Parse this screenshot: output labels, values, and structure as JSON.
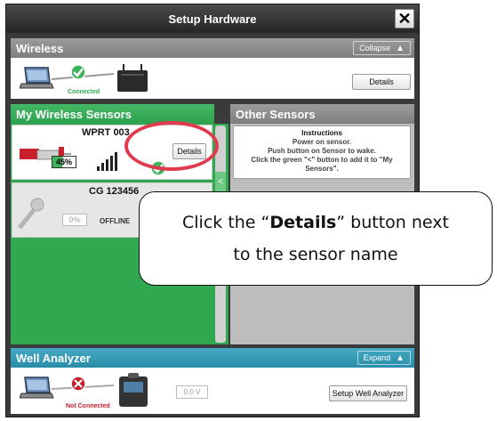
{
  "dialog": {
    "title": "Setup Hardware",
    "close_label": "✕"
  },
  "wireless": {
    "header": "Wireless",
    "collapse_label": "Collapse",
    "status": "Connected",
    "details_label": "Details"
  },
  "my_sensors": {
    "header": "My Wireless Sensors",
    "sensors": [
      {
        "name": "WPRT 003",
        "battery": "45%",
        "details_label": "Details"
      },
      {
        "name": "CG 123456",
        "battery": "0%",
        "status": "OFFLINE"
      }
    ],
    "scroll_tab_label": "<"
  },
  "other_sensors": {
    "header": "Other Sensors",
    "instructions_title": "Instructions",
    "instructions_lines": [
      "Power on sensor.",
      "Push button on Sensor to wake.",
      "Click the green \"<\" button to add it to \"My",
      "Sensors\"."
    ]
  },
  "well_analyzer": {
    "header": "Well Analyzer",
    "expand_label": "Expand",
    "status": "Not Connected",
    "voltage": "0.0 V",
    "setup_label": "Setup Well Analyzer"
  },
  "callout": {
    "line1_pre": "Click the “",
    "line1_bold": "Details",
    "line1_post": "” button next",
    "line2": "to the sensor name"
  },
  "colors": {
    "accent_green": "#2fa84f",
    "accent_teal": "#2a8ea9",
    "highlight_red": "#e03a4e"
  }
}
